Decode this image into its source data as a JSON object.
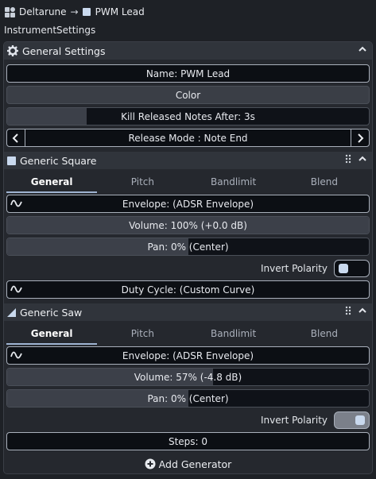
{
  "breadcrumb": {
    "project": "Deltarune",
    "arrow": "→",
    "instrument": "PWM Lead"
  },
  "context_label": "InstrumentSettings",
  "general_settings": {
    "title": "General Settings",
    "name_field": "Name: PWM Lead",
    "color_button": "Color",
    "kill_released": {
      "label": "Kill Released Notes After: 3s",
      "fill_fraction": 0.22
    },
    "release_mode": "Release Mode : Note End"
  },
  "generators": [
    {
      "title": "Generic Square",
      "tabs": [
        "General",
        "Pitch",
        "Bandlimit",
        "Blend"
      ],
      "active_tab": "General",
      "envelope": "Envelope: (ADSR Envelope)",
      "volume": {
        "label": "Volume: 100% (+0.0 dB)",
        "fill_fraction": 1.0
      },
      "pan": {
        "label": "Pan: 0% (Center)",
        "fill_fraction": 0.5
      },
      "invert_polarity": {
        "label": "Invert Polarity",
        "on": false
      },
      "extra": "Duty Cycle: (Custom Curve)"
    },
    {
      "title": "Generic Saw",
      "tabs": [
        "General",
        "Pitch",
        "Bandlimit",
        "Blend"
      ],
      "active_tab": "General",
      "envelope": "Envelope: (ADSR Envelope)",
      "volume": {
        "label": "Volume: 57% (-4.8 dB)",
        "fill_fraction": 0.57
      },
      "pan": {
        "label": "Pan: 0% (Center)",
        "fill_fraction": 0.5
      },
      "invert_polarity": {
        "label": "Invert Polarity",
        "on": true
      },
      "extra": "Steps: 0"
    }
  ],
  "add_generator_label": "Add Generator",
  "colors": {
    "accent": "#9fb4d2",
    "square_icon": "#c9d9ee",
    "panel": "#25282e"
  }
}
